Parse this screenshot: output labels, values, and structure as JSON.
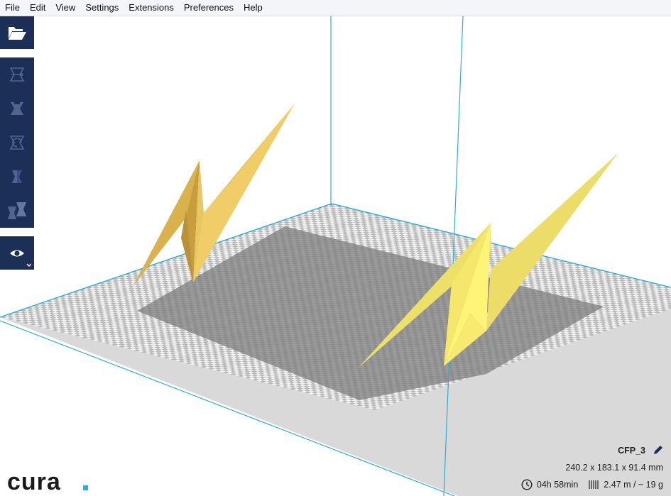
{
  "menu": [
    "File",
    "Edit",
    "View",
    "Settings",
    "Extensions",
    "Preferences",
    "Help"
  ],
  "job": {
    "name": "CFP_3",
    "dimensions": "240.2 x 183.1 x 91.4 mm",
    "print_time": "04h 58min",
    "material": "2.47 m / ~ 19 g"
  },
  "logo_text": "cura.",
  "tools": {
    "open": "open-file-icon",
    "move": "move-icon",
    "scale": "scale-icon",
    "rotate": "rotate-icon",
    "mirror": "mirror-icon",
    "per_model": "per-model-settings-icon",
    "view": "eye-icon"
  },
  "colors": {
    "sidebar": "#1c2f57",
    "model_left": "#e9c45b",
    "model_right": "#f8e46b",
    "axis": "#2ab0d6",
    "plate_dark": "#b3b3b3",
    "plate_light": "#f2f2f2",
    "shadow": "#808080"
  }
}
